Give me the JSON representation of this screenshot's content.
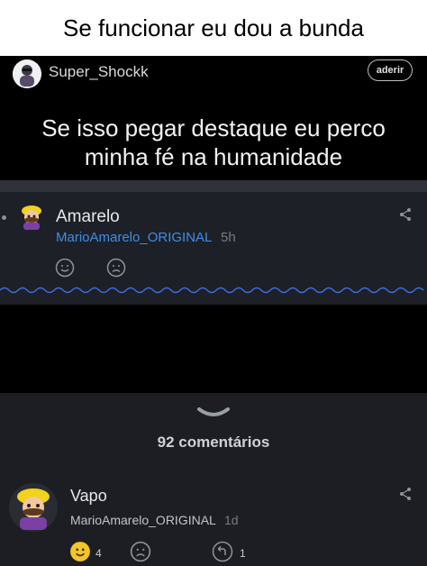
{
  "banner": {
    "text": "Se funcionar eu dou a bunda"
  },
  "post": {
    "username": "Super_Shockk",
    "join_label": "aderir",
    "text_line1": "Se isso pegar destaque eu perco",
    "text_line2": "minha fé na humanidade"
  },
  "comment": {
    "name": "Amarelo",
    "username": "MarioAmarelo_ORIGINAL",
    "time": "5h"
  },
  "comments_count": "92 comentários",
  "bottom_comment": {
    "name": "Vapo",
    "username": "MarioAmarelo_ORIGINAL",
    "time": "1d",
    "likes": "4",
    "replies": "1"
  },
  "colors": {
    "link": "#3d8fe8",
    "like_active": "#f4c52b",
    "squiggle": "#3b6fd9"
  },
  "icons": [
    "avatar",
    "share-icon",
    "smile-icon",
    "sad-icon",
    "chevron-down-icon",
    "reply-icon"
  ]
}
